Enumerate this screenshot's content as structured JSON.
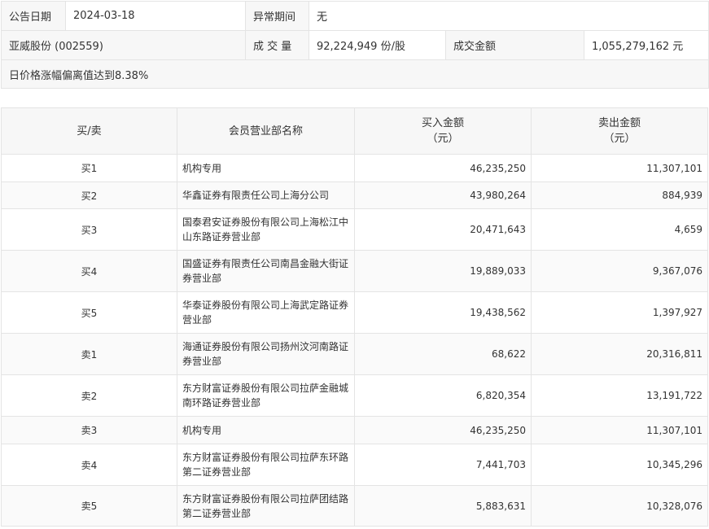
{
  "info": {
    "date_label": "公告日期",
    "date_value": "2024-03-18",
    "period_label": "异常期间",
    "period_value": "无",
    "stock": "亚威股份 (002559)",
    "volume_label": "成 交 量",
    "volume_value": "92,224,949 份/股",
    "amount_label": "成交金额",
    "amount_value": "1,055,279,162 元",
    "reason": "日价格涨幅偏离值达到8.38%"
  },
  "table": {
    "headers": {
      "side": "买/卖",
      "branch": "会员营业部名称",
      "buy_line1": "买入金额",
      "buy_line2": "（元）",
      "sell_line1": "卖出金额",
      "sell_line2": "（元）"
    },
    "rows": [
      {
        "side": "买1",
        "branch": "机构专用",
        "buy": "46,235,250",
        "sell": "11,307,101"
      },
      {
        "side": "买2",
        "branch": "华鑫证券有限责任公司上海分公司",
        "buy": "43,980,264",
        "sell": "884,939"
      },
      {
        "side": "买3",
        "branch": "国泰君安证券股份有限公司上海松江中山东路证券营业部",
        "buy": "20,471,643",
        "sell": "4,659"
      },
      {
        "side": "买4",
        "branch": "国盛证券有限责任公司南昌金融大街证券营业部",
        "buy": "19,889,033",
        "sell": "9,367,076"
      },
      {
        "side": "买5",
        "branch": "华泰证券股份有限公司上海武定路证券营业部",
        "buy": "19,438,562",
        "sell": "1,397,927"
      },
      {
        "side": "卖1",
        "branch": "海通证券股份有限公司扬州汶河南路证券营业部",
        "buy": "68,622",
        "sell": "20,316,811"
      },
      {
        "side": "卖2",
        "branch": "东方财富证券股份有限公司拉萨金融城南环路证券营业部",
        "buy": "6,820,354",
        "sell": "13,191,722"
      },
      {
        "side": "卖3",
        "branch": "机构专用",
        "buy": "46,235,250",
        "sell": "11,307,101"
      },
      {
        "side": "卖4",
        "branch": "东方财富证券股份有限公司拉萨东环路第二证券营业部",
        "buy": "7,441,703",
        "sell": "10,345,296"
      },
      {
        "side": "卖5",
        "branch": "东方财富证券股份有限公司拉萨团结路第二证券营业部",
        "buy": "5,883,631",
        "sell": "10,328,076"
      }
    ]
  }
}
